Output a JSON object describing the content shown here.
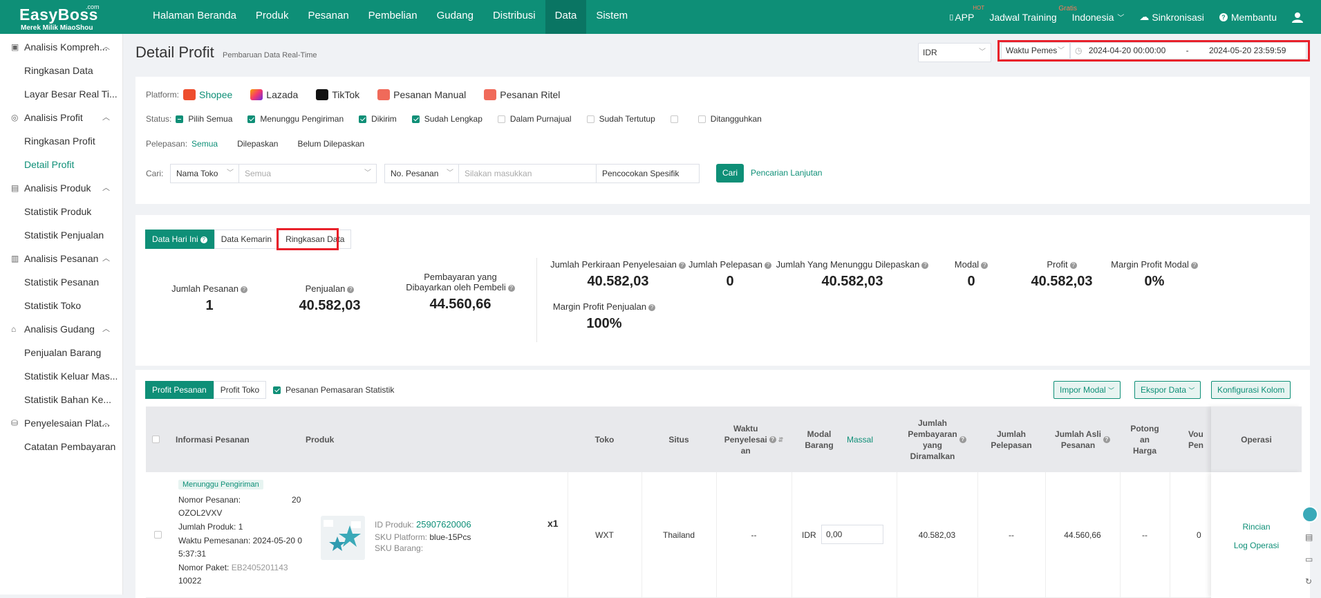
{
  "topbar": {
    "logo_com": ".com",
    "logo_brand": "EasyBoss",
    "logo_sub": "Merek Milik MiaoShou",
    "nav": [
      "Halaman Beranda",
      "Produk",
      "Pesanan",
      "Pembelian",
      "Gudang",
      "Distribusi",
      "Data",
      "Sistem"
    ],
    "active_nav": "Data",
    "app": "APP",
    "app_sup": "HOT",
    "training": "Jadwal Training",
    "training_sup": "Gratis",
    "language": "Indonesia",
    "sync": "Sinkronisasi",
    "help": "Membantu"
  },
  "sidebar": {
    "groups": [
      {
        "label": "Analisis Kompreh...",
        "items": [
          "Ringkasan Data",
          "Layar Besar Real Ti..."
        ]
      },
      {
        "label": "Analisis Profit",
        "items": [
          "Ringkasan Profit",
          "Detail Profit"
        ]
      },
      {
        "label": "Analisis Produk",
        "items": [
          "Statistik Produk",
          "Statistik Penjualan"
        ]
      },
      {
        "label": "Analisis Pesanan",
        "items": [
          "Statistik Pesanan",
          "Statistik Toko"
        ]
      },
      {
        "label": "Analisis Gudang",
        "items": [
          "Penjualan Barang",
          "Statistik Keluar Mas...",
          "Statistik Bahan Ke..."
        ]
      },
      {
        "label": "Penyelesaian Plat...",
        "items": [
          "Catatan Pembayaran"
        ]
      }
    ],
    "active_item": "Detail Profit"
  },
  "header": {
    "title": "Detail Profit",
    "subtitle": "Pembaruan Data Real-Time",
    "currency": "IDR",
    "time_type": "Waktu Pemes",
    "date_start": "2024-04-20 00:00:00",
    "date_sep": "-",
    "date_end": "2024-05-20 23:59:59"
  },
  "filters": {
    "platform_label": "Platform:",
    "platforms": [
      "Shopee",
      "Lazada",
      "TikTok",
      "Pesanan Manual",
      "Pesanan Ritel"
    ],
    "status_label": "Status:",
    "statuses": [
      {
        "label": "Pilih Semua",
        "state": "partial"
      },
      {
        "label": "Menunggu Pengiriman",
        "state": "on"
      },
      {
        "label": "Dikirim",
        "state": "on"
      },
      {
        "label": "Sudah Lengkap",
        "state": "on"
      },
      {
        "label": "Dalam Purnajual",
        "state": "off"
      },
      {
        "label": "Sudah Tertutup",
        "state": "off"
      },
      {
        "label": "",
        "state": "off"
      },
      {
        "label": "Ditangguhkan",
        "state": "off"
      }
    ],
    "release_label": "Pelepasan:",
    "releases": [
      "Semua",
      "Dilepaskan",
      "Belum Dilepaskan"
    ],
    "search_label": "Cari:",
    "store_select": "Nama Toko",
    "store_value": "Semua",
    "order_select": "No. Pesanan",
    "order_placeholder": "Silakan masukkan",
    "match_select": "Pencocokan Spesifik",
    "search_button": "Cari",
    "advanced": "Pencarian Lanjutan"
  },
  "summary": {
    "tabs": [
      "Data Hari Ini",
      "Data Kemarin",
      "Ringkasan Data"
    ],
    "left": [
      {
        "label": "Jumlah Pesanan",
        "value": "1"
      },
      {
        "label": "Penjualan",
        "value": "40.582,03"
      },
      {
        "label": "Pembayaran yang",
        "label2": "Dibayarkan oleh Pembeli",
        "value": "44.560,66"
      }
    ],
    "right": [
      {
        "label": "Jumlah Perkiraan Penyelesaian",
        "value": "40.582,03"
      },
      {
        "label": "Jumlah Pelepasan",
        "value": "0"
      },
      {
        "label": "Jumlah Yang Menunggu Dilepaskan",
        "value": "40.582,03"
      },
      {
        "label": "Modal",
        "value": "0"
      },
      {
        "label": "Profit",
        "value": "40.582,03"
      },
      {
        "label": "Margin Profit Modal",
        "value": "0%"
      },
      {
        "label": "Margin Profit Penjualan",
        "value": "100%"
      }
    ]
  },
  "table": {
    "tabs": [
      "Profit Pesanan",
      "Profit Toko"
    ],
    "marketing_check": "Pesanan Pemasaran Statistik",
    "import": "Impor Modal",
    "export": "Ekspor Data",
    "config": "Konfigurasi Kolom",
    "headers": {
      "info": "Informasi Pesanan",
      "product": "Produk",
      "store": "Toko",
      "site": "Situs",
      "settle_time": [
        "Waktu",
        "Penyelesai",
        "an"
      ],
      "cost": [
        "Modal",
        "Barang"
      ],
      "bulk": "Massal",
      "payment": [
        "Jumlah",
        "Pembayaran",
        "yang",
        "Diramalkan"
      ],
      "release": [
        "Jumlah",
        "Pelepasan"
      ],
      "original": [
        "Jumlah Asli",
        "Pesanan"
      ],
      "discount": [
        "Potong",
        "an",
        "Harga"
      ],
      "voucher": [
        "Vou",
        "Pen"
      ],
      "operation": "Operasi"
    },
    "row": {
      "status": "Menunggu Pengiriman",
      "order_no_label": "Nomor Pesanan:",
      "order_no_tail": "20",
      "order_no_line2": "OZOL2VXV",
      "qty_label": "Jumlah Produk:",
      "qty_value": "1",
      "order_time_label": "Waktu Pemesanan:",
      "order_time_value": "2024-05-20 0",
      "order_time_line2": "5:37:31",
      "package_label": "Nomor Paket:",
      "package_value": "EB2405201143",
      "package_line2": "10022",
      "product_id_label": "ID Produk:",
      "product_id": "25907620006",
      "sku_platform_label": "SKU Platform:",
      "sku_platform": "blue-15Pcs",
      "sku_item_label": "SKU Barang:",
      "quantity": "x1",
      "store": "WXT",
      "site": "Thailand",
      "settle_time": "--",
      "cost_currency": "IDR",
      "cost_value": "0,00",
      "payment": "40.582,03",
      "release": "--",
      "original": "44.560,66",
      "discount": "--",
      "voucher": "0",
      "detail": "Rincian",
      "log": "Log Operasi"
    }
  }
}
